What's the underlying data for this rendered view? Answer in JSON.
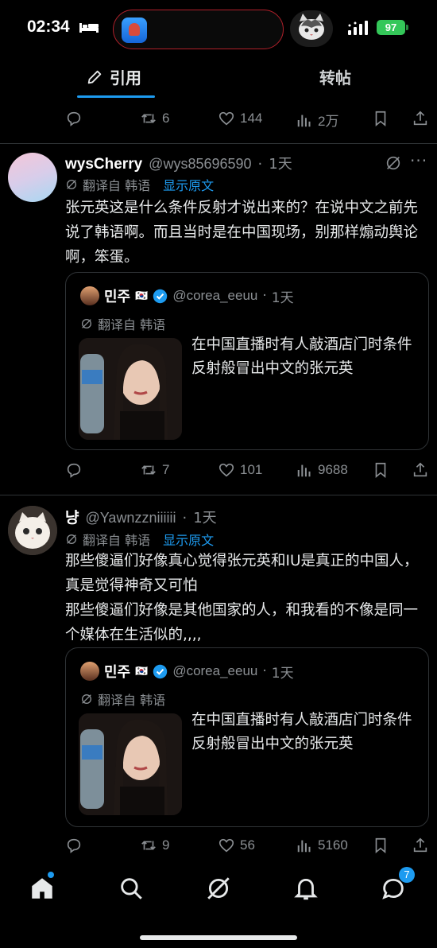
{
  "status_bar": {
    "time": "02:34",
    "battery": "97"
  },
  "tabs": {
    "quote": "引用",
    "repost": "转帖"
  },
  "top_actions": {
    "reposts": "6",
    "likes": "144",
    "views": "2万"
  },
  "tweets": [
    {
      "name": "wysCherry",
      "handle": "@wys85696590",
      "dot": "·",
      "time": "1天",
      "translated_from": "翻译自 韩语",
      "show_original": "显示原文",
      "body": "张元英这是什么条件反射才说出来的？在说中文之前先说了韩语啊。而且当时是在中国现场，别那样煽动舆论啊，笨蛋。",
      "quote": {
        "name": "민주",
        "flag": "🇰🇷",
        "handle": "@corea_eeuu",
        "dot": "·",
        "time": "1天",
        "translated_from": "翻译自 韩语",
        "text": "在中国直播时有人敲酒店门时条件反射般冒出中文的张元英"
      },
      "actions": {
        "reposts": "7",
        "likes": "101",
        "views": "9688"
      }
    },
    {
      "name": "냥",
      "handle": "@Yawnzzniiiiii",
      "dot": "·",
      "time": "1天",
      "translated_from": "翻译自 韩语",
      "show_original": "显示原文",
      "body": "那些傻逼们好像真心觉得张元英和IU是真正的中国人，真是觉得神奇又可怕\n那些傻逼们好像是其他国家的人，和我看的不像是同一个媒体在生活似的,,,,",
      "quote": {
        "name": "민주",
        "flag": "🇰🇷",
        "handle": "@corea_eeuu",
        "dot": "·",
        "time": "1天",
        "translated_from": "翻译自 韩语",
        "text": "在中国直播时有人敲酒店门时条件反射般冒出中文的张元英"
      },
      "actions": {
        "reposts": "9",
        "likes": "56",
        "views": "5160"
      }
    }
  ],
  "bottom_nav": {
    "messages_badge": "7"
  },
  "colors": {
    "accent": "#1d9bf0",
    "background": "#000000",
    "muted": "#8b8f93",
    "battery": "#34c759"
  }
}
